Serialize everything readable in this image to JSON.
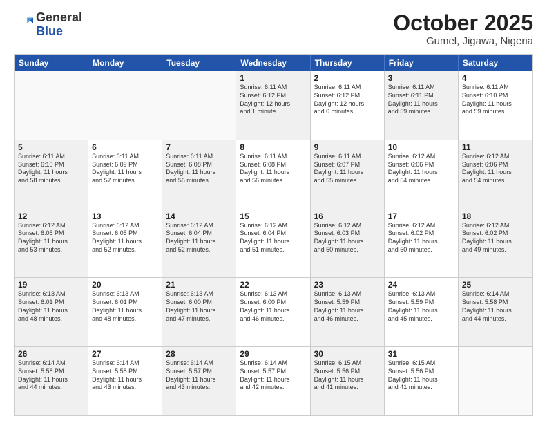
{
  "logo": {
    "general": "General",
    "blue": "Blue"
  },
  "header": {
    "month": "October 2025",
    "location": "Gumel, Jigawa, Nigeria"
  },
  "weekdays": [
    "Sunday",
    "Monday",
    "Tuesday",
    "Wednesday",
    "Thursday",
    "Friday",
    "Saturday"
  ],
  "rows": [
    [
      {
        "day": "",
        "text": "",
        "empty": true
      },
      {
        "day": "",
        "text": "",
        "empty": true
      },
      {
        "day": "",
        "text": "",
        "empty": true
      },
      {
        "day": "1",
        "text": "Sunrise: 6:11 AM\nSunset: 6:12 PM\nDaylight: 12 hours\nand 1 minute.",
        "shaded": true
      },
      {
        "day": "2",
        "text": "Sunrise: 6:11 AM\nSunset: 6:12 PM\nDaylight: 12 hours\nand 0 minutes.",
        "shaded": false
      },
      {
        "day": "3",
        "text": "Sunrise: 6:11 AM\nSunset: 6:11 PM\nDaylight: 11 hours\nand 59 minutes.",
        "shaded": true
      },
      {
        "day": "4",
        "text": "Sunrise: 6:11 AM\nSunset: 6:10 PM\nDaylight: 11 hours\nand 59 minutes.",
        "shaded": false
      }
    ],
    [
      {
        "day": "5",
        "text": "Sunrise: 6:11 AM\nSunset: 6:10 PM\nDaylight: 11 hours\nand 58 minutes.",
        "shaded": true
      },
      {
        "day": "6",
        "text": "Sunrise: 6:11 AM\nSunset: 6:09 PM\nDaylight: 11 hours\nand 57 minutes.",
        "shaded": false
      },
      {
        "day": "7",
        "text": "Sunrise: 6:11 AM\nSunset: 6:08 PM\nDaylight: 11 hours\nand 56 minutes.",
        "shaded": true
      },
      {
        "day": "8",
        "text": "Sunrise: 6:11 AM\nSunset: 6:08 PM\nDaylight: 11 hours\nand 56 minutes.",
        "shaded": false
      },
      {
        "day": "9",
        "text": "Sunrise: 6:11 AM\nSunset: 6:07 PM\nDaylight: 11 hours\nand 55 minutes.",
        "shaded": true
      },
      {
        "day": "10",
        "text": "Sunrise: 6:12 AM\nSunset: 6:06 PM\nDaylight: 11 hours\nand 54 minutes.",
        "shaded": false
      },
      {
        "day": "11",
        "text": "Sunrise: 6:12 AM\nSunset: 6:06 PM\nDaylight: 11 hours\nand 54 minutes.",
        "shaded": true
      }
    ],
    [
      {
        "day": "12",
        "text": "Sunrise: 6:12 AM\nSunset: 6:05 PM\nDaylight: 11 hours\nand 53 minutes.",
        "shaded": true
      },
      {
        "day": "13",
        "text": "Sunrise: 6:12 AM\nSunset: 6:05 PM\nDaylight: 11 hours\nand 52 minutes.",
        "shaded": false
      },
      {
        "day": "14",
        "text": "Sunrise: 6:12 AM\nSunset: 6:04 PM\nDaylight: 11 hours\nand 52 minutes.",
        "shaded": true
      },
      {
        "day": "15",
        "text": "Sunrise: 6:12 AM\nSunset: 6:04 PM\nDaylight: 11 hours\nand 51 minutes.",
        "shaded": false
      },
      {
        "day": "16",
        "text": "Sunrise: 6:12 AM\nSunset: 6:03 PM\nDaylight: 11 hours\nand 50 minutes.",
        "shaded": true
      },
      {
        "day": "17",
        "text": "Sunrise: 6:12 AM\nSunset: 6:02 PM\nDaylight: 11 hours\nand 50 minutes.",
        "shaded": false
      },
      {
        "day": "18",
        "text": "Sunrise: 6:12 AM\nSunset: 6:02 PM\nDaylight: 11 hours\nand 49 minutes.",
        "shaded": true
      }
    ],
    [
      {
        "day": "19",
        "text": "Sunrise: 6:13 AM\nSunset: 6:01 PM\nDaylight: 11 hours\nand 48 minutes.",
        "shaded": true
      },
      {
        "day": "20",
        "text": "Sunrise: 6:13 AM\nSunset: 6:01 PM\nDaylight: 11 hours\nand 48 minutes.",
        "shaded": false
      },
      {
        "day": "21",
        "text": "Sunrise: 6:13 AM\nSunset: 6:00 PM\nDaylight: 11 hours\nand 47 minutes.",
        "shaded": true
      },
      {
        "day": "22",
        "text": "Sunrise: 6:13 AM\nSunset: 6:00 PM\nDaylight: 11 hours\nand 46 minutes.",
        "shaded": false
      },
      {
        "day": "23",
        "text": "Sunrise: 6:13 AM\nSunset: 5:59 PM\nDaylight: 11 hours\nand 46 minutes.",
        "shaded": true
      },
      {
        "day": "24",
        "text": "Sunrise: 6:13 AM\nSunset: 5:59 PM\nDaylight: 11 hours\nand 45 minutes.",
        "shaded": false
      },
      {
        "day": "25",
        "text": "Sunrise: 6:14 AM\nSunset: 5:58 PM\nDaylight: 11 hours\nand 44 minutes.",
        "shaded": true
      }
    ],
    [
      {
        "day": "26",
        "text": "Sunrise: 6:14 AM\nSunset: 5:58 PM\nDaylight: 11 hours\nand 44 minutes.",
        "shaded": true
      },
      {
        "day": "27",
        "text": "Sunrise: 6:14 AM\nSunset: 5:58 PM\nDaylight: 11 hours\nand 43 minutes.",
        "shaded": false
      },
      {
        "day": "28",
        "text": "Sunrise: 6:14 AM\nSunset: 5:57 PM\nDaylight: 11 hours\nand 43 minutes.",
        "shaded": true
      },
      {
        "day": "29",
        "text": "Sunrise: 6:14 AM\nSunset: 5:57 PM\nDaylight: 11 hours\nand 42 minutes.",
        "shaded": false
      },
      {
        "day": "30",
        "text": "Sunrise: 6:15 AM\nSunset: 5:56 PM\nDaylight: 11 hours\nand 41 minutes.",
        "shaded": true
      },
      {
        "day": "31",
        "text": "Sunrise: 6:15 AM\nSunset: 5:56 PM\nDaylight: 11 hours\nand 41 minutes.",
        "shaded": false
      },
      {
        "day": "",
        "text": "",
        "empty": true
      }
    ]
  ]
}
